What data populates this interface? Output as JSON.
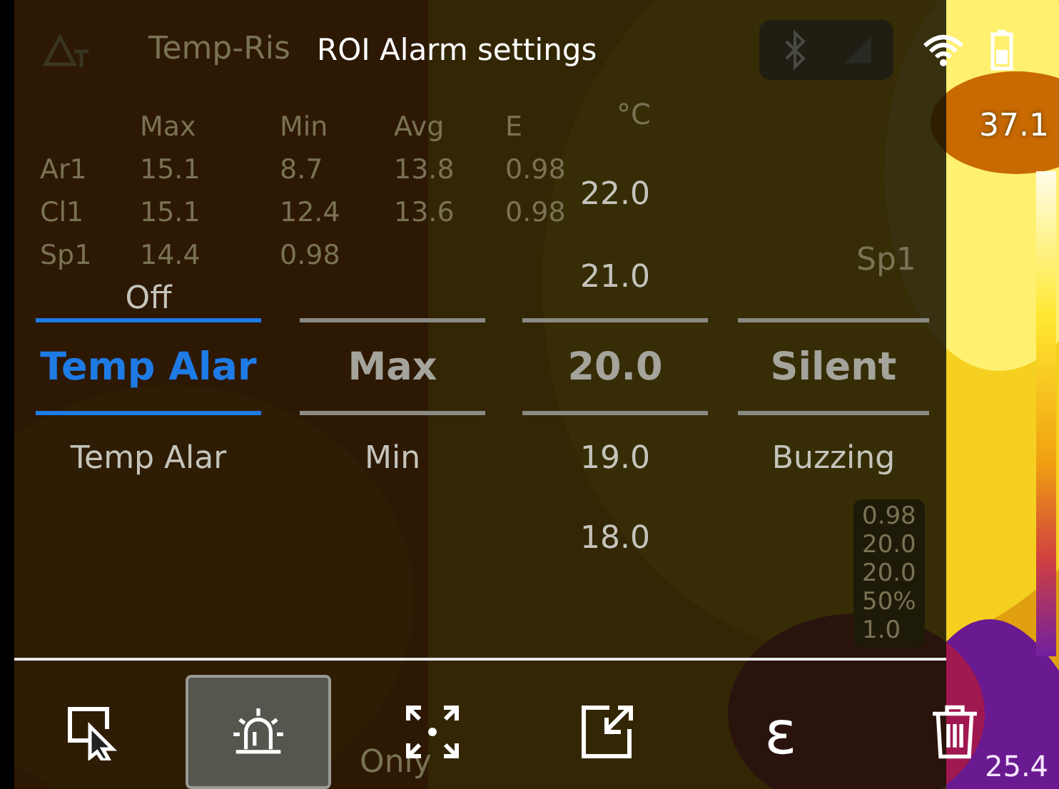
{
  "title": "ROI Alarm settings",
  "hud": {
    "mode_text": "Temp-Ris",
    "unit": "°C",
    "scale_max": "37.1",
    "spot_label": "Sp1",
    "scale_min": "25.4",
    "footer_text": "Only",
    "table": {
      "columns": [
        "",
        "Max",
        "Min",
        "Avg",
        "E"
      ],
      "rows": [
        [
          "Ar1",
          "15.1",
          "8.7",
          "13.8",
          "0.98"
        ],
        [
          "Cl1",
          "15.1",
          "12.4",
          "13.6",
          "0.98"
        ],
        [
          "Sp1",
          "14.4",
          "0.98"
        ]
      ]
    },
    "readings": [
      "0.98",
      "20.0",
      "20.0",
      "50%",
      "1.0"
    ]
  },
  "picker": [
    {
      "active": true,
      "above": [
        "Off"
      ],
      "current": "Temp Alar",
      "below": [
        "Temp Alar"
      ]
    },
    {
      "active": false,
      "current": "Max",
      "below": [
        "Min"
      ]
    },
    {
      "active": false,
      "above": [
        "22.0",
        "21.0"
      ],
      "current": "20.0",
      "below": [
        "19.0",
        "18.0"
      ]
    },
    {
      "active": false,
      "current": "Silent",
      "below": [
        "Buzzing"
      ]
    }
  ],
  "toolbar": [
    {
      "kind": "select",
      "selected": false
    },
    {
      "kind": "alarm",
      "selected": true
    },
    {
      "kind": "focus",
      "selected": false
    },
    {
      "kind": "export",
      "selected": false
    },
    {
      "kind": "text",
      "label": "ε",
      "selected": false
    },
    {
      "kind": "delete",
      "selected": false
    }
  ]
}
